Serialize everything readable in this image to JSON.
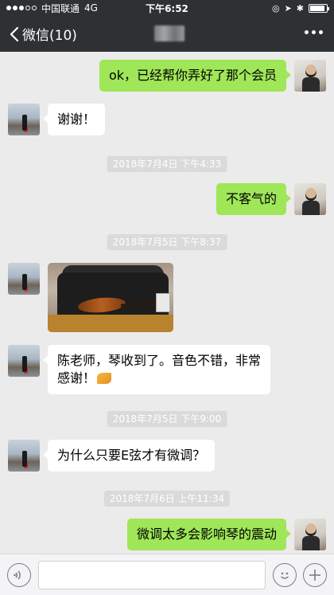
{
  "status_bar": {
    "carrier": "中国联通",
    "network": "4G",
    "time": "下午6:52"
  },
  "nav": {
    "back_label": "微信(10)"
  },
  "messages": [
    {
      "from": "me",
      "text": "ok，已经帮你弄好了那个会员"
    },
    {
      "from": "other",
      "text": "谢谢！"
    },
    {
      "type": "timestamp",
      "text": "2018年7月4日 下午4:33"
    },
    {
      "from": "me",
      "text": "不客气的"
    },
    {
      "type": "timestamp",
      "text": "2018年7月5日 下午8:37"
    },
    {
      "from": "other",
      "type": "image"
    },
    {
      "from": "other",
      "text_line1": "陈老师，琴收到了。音色不错，非常",
      "text_line2": "感谢！"
    },
    {
      "type": "timestamp",
      "text": "2018年7月5日 下午9:00"
    },
    {
      "from": "other",
      "text": "为什么只要E弦才有微调？"
    },
    {
      "type": "timestamp",
      "text": "2018年7月6日 上午11:34"
    },
    {
      "from": "me",
      "text": "微调太多会影响琴的震动"
    }
  ],
  "input_bar": {
    "message_value": ""
  },
  "colors": {
    "header_bg": "#2e3133",
    "chat_bg": "#ebebeb",
    "my_bubble": "#9fe658",
    "their_bubble": "#ffffff"
  }
}
